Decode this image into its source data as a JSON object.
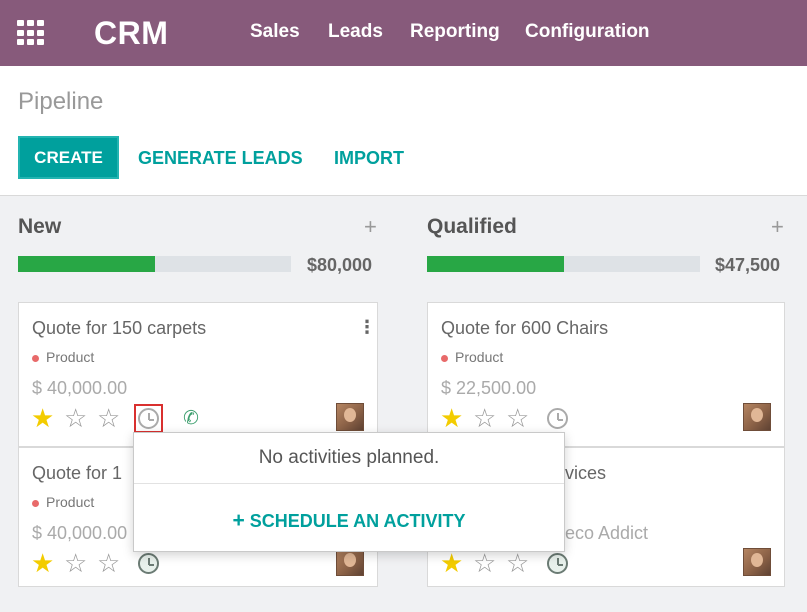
{
  "navbar": {
    "app_name": "CRM",
    "menu": [
      "Sales",
      "Leads",
      "Reporting",
      "Configuration"
    ]
  },
  "control_panel": {
    "breadcrumb": "Pipeline",
    "buttons": {
      "create": "CREATE",
      "generate_leads": "GENERATE LEADS",
      "import": "IMPORT"
    }
  },
  "kanban": {
    "columns": [
      {
        "title": "New",
        "add": "+",
        "total": "$80,000",
        "progress": 0.5,
        "cards": [
          {
            "title": "Quote for 150 carpets",
            "tag": "Product",
            "amount": "$ 40,000.00",
            "stars": 1
          },
          {
            "title": "Quote for 1",
            "tag": "Product",
            "amount": "$ 40,000.00",
            "stars": 1
          }
        ]
      },
      {
        "title": "Qualified",
        "add": "+",
        "total": "$47,500",
        "progress": 0.5,
        "cards": [
          {
            "title": "Quote for 600 Chairs",
            "tag": "Product",
            "amount": "$ 22,500.00",
            "stars": 1
          },
          {
            "title": "vices",
            "amount": "eco Addict",
            "stars": 1
          }
        ]
      }
    ]
  },
  "popover": {
    "empty_text": "No activities planned.",
    "action_plus": "+",
    "action_label": "SCHEDULE AN ACTIVITY"
  },
  "colors": {
    "navbar": "#875a7b",
    "accent": "#00a09d",
    "progress": "#28a745",
    "star": "#f3cc00",
    "highlight": "#d9302f"
  },
  "icons": [
    "apps-grid-icon",
    "star-icon",
    "clock-icon",
    "phone-plus-icon",
    "kebab-menu-icon",
    "plus-icon"
  ]
}
